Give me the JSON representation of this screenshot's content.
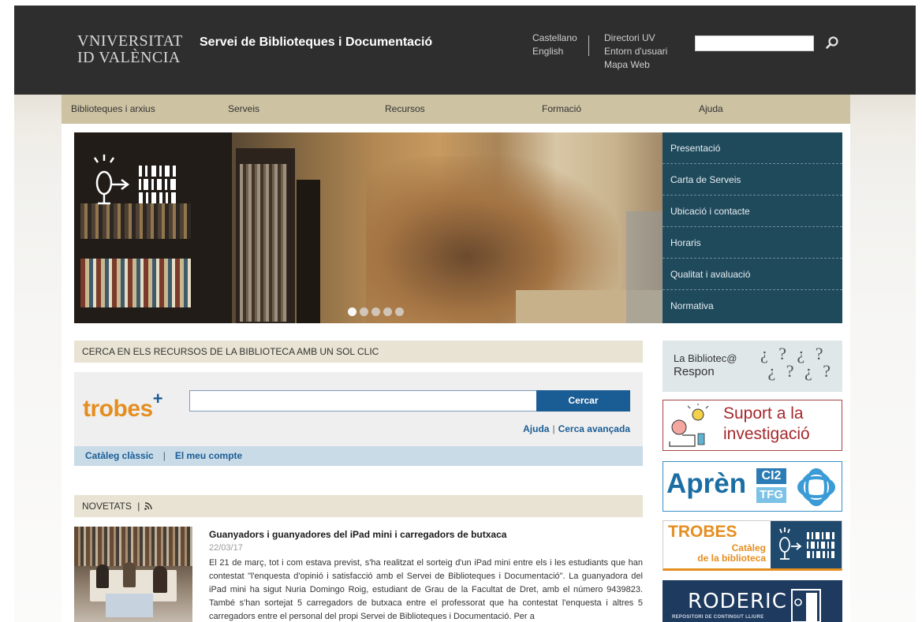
{
  "header": {
    "logo_line1": "VNIVERSITAT",
    "logo_line2": "ID VALÈNCIA",
    "site_title": "Servei de Biblioteques i Documentació",
    "languages": [
      "Castellano",
      "English"
    ],
    "links": [
      "Directori UV",
      "Entorn d'usuari",
      "Mapa Web"
    ],
    "search_placeholder": ""
  },
  "nav": [
    "Biblioteques i arxius",
    "Serveis",
    "Recursos",
    "Formació",
    "Ajuda"
  ],
  "side_menu": [
    "Presentació",
    "Carta de Serveis",
    "Ubicació i contacte",
    "Horaris",
    "Qualitat i avaluació",
    "Normativa"
  ],
  "search_section": {
    "heading": "CERCA EN ELS RECURSOS DE LA BIBLIOTECA AMB UN SOL CLIC",
    "logo_text": "trobes",
    "logo_plus": "+",
    "button": "Cercar",
    "link_help": "Ajuda",
    "link_advanced": "Cerca avançada",
    "link_catalog": "Catàleg clàssic",
    "link_account": "El meu compte",
    "sep": "|"
  },
  "news": {
    "heading": "NOVETATS",
    "title": "Guanyadors i guanyadores del iPad mini i carregadors de butxaca",
    "date": "22/03/17",
    "body": "El 21 de març, tot i com estava previst, s'ha realitzat el sorteig d'un iPad mini entre els i les estudiants que han contestat \"l'enquesta d'opinió i satisfacció amb el Servei de Biblioteques i Documentació\". La guanyadora del iPad mini ha sigut Nuria Domingo Roig, estudiant de Grau de la Facultat de Dret, amb el número 9439823. També s'han sortejat 5 carregadors de butxaca entre el professorat que ha contestat l'enquesta i altres 5 carregadors entre el personal del propi Servei de Biblioteques i Documentació. Per a"
  },
  "banners": {
    "b1_line1": "La Bibliotec@",
    "b1_line2": "Respon",
    "b2_line1": "Suport a la",
    "b2_line2": "investigació",
    "b3_text": "Aprèn",
    "b3_badge1": "CI2",
    "b3_badge2": "TFG",
    "b4_title": "TROBES",
    "b4_sub1": "Catàleg",
    "b4_sub2": "de la biblioteca",
    "b5_title": "RODERIC",
    "b5_sub": "REPOSITORI DE CONTINGUT LLIURE"
  },
  "colors": {
    "header_bg": "#2e2e2e",
    "nav_bg": "#cdc2a2",
    "side_menu_bg": "#1f4a5c",
    "accent_blue": "#1a5d95",
    "accent_orange": "#e58e20"
  },
  "slider": {
    "dots": 5,
    "active": 1
  }
}
